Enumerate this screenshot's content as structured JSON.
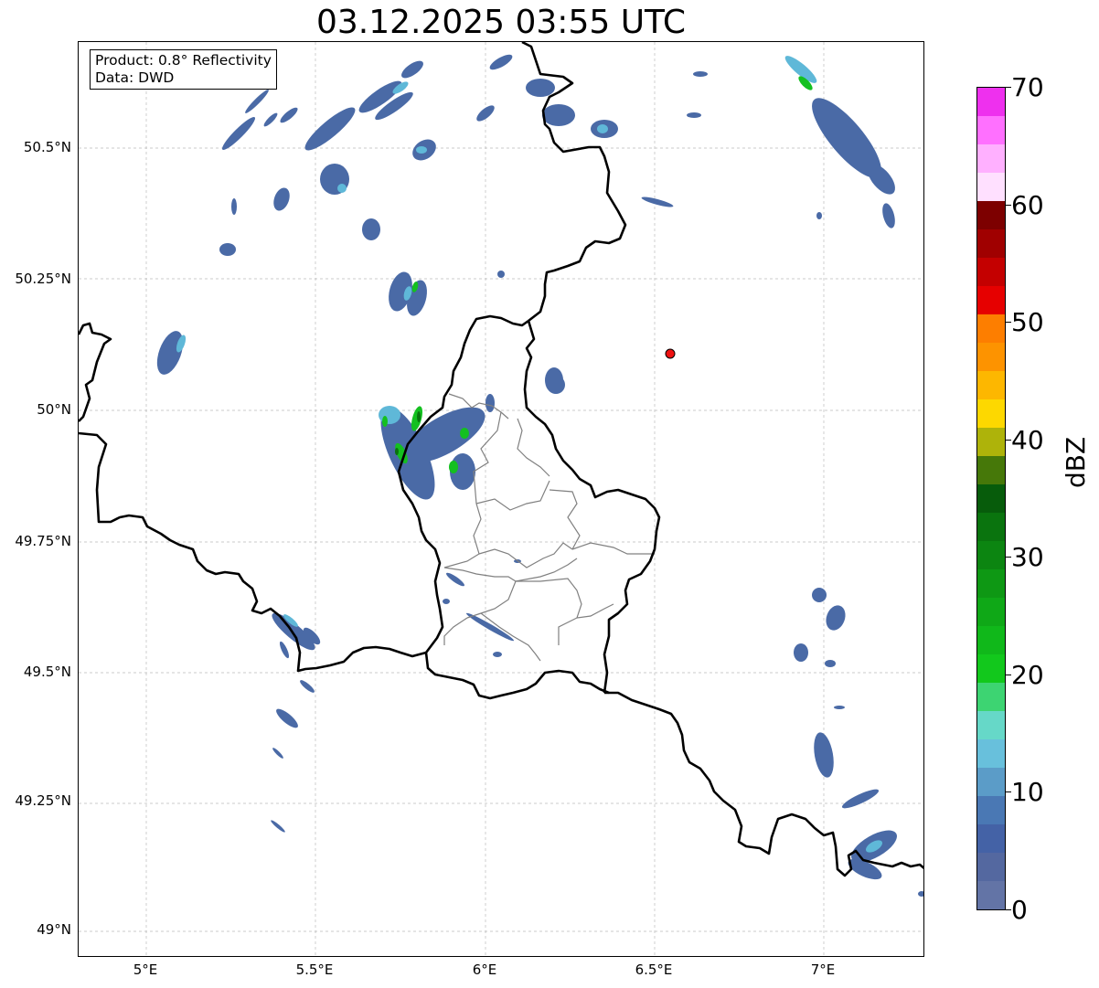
{
  "title": "03.12.2025 03:55 UTC",
  "annotation": {
    "product": "Product: 0.8° Reflectivity",
    "data_source": "Data: DWD"
  },
  "axes": {
    "lon_ticks": [
      "5°E",
      "5.5°E",
      "6°E",
      "6.5°E",
      "7°E"
    ],
    "lat_ticks": [
      "49°N",
      "49.25°N",
      "49.5°N",
      "49.75°N",
      "50°N",
      "50.25°N",
      "50.5°N"
    ],
    "lon_range": [
      4.8,
      7.3
    ],
    "lat_range": [
      48.95,
      50.7
    ],
    "grid": true
  },
  "colorbar": {
    "label": "dBZ",
    "ticks": [
      "0",
      "10",
      "20",
      "30",
      "40",
      "50",
      "60",
      "70"
    ],
    "range": [
      0,
      70
    ],
    "colors": [
      "#6374a6",
      "#5468a0",
      "#4462a6",
      "#4a78b4",
      "#5b9cc8",
      "#68c0dc",
      "#66d8c8",
      "#3dd472",
      "#12c81c",
      "#10b81a",
      "#0fa817",
      "#0e9814",
      "#0c8511",
      "#0a740e",
      "#075c0b",
      "#467809",
      "#aeb30a",
      "#fdd800",
      "#fdb700",
      "#fd9300",
      "#fd7e00",
      "#e60000",
      "#c40000",
      "#a00000",
      "#7d0000",
      "#ffe0ff",
      "#ffb0ff",
      "#ff70ff",
      "#ee30ee"
    ]
  },
  "station_marker": {
    "lon": 6.55,
    "lat": 50.11,
    "color": "#ee1111"
  },
  "colors": {
    "border": "#000000",
    "admin_border": "#808080",
    "grid": "#bbbbbb"
  }
}
